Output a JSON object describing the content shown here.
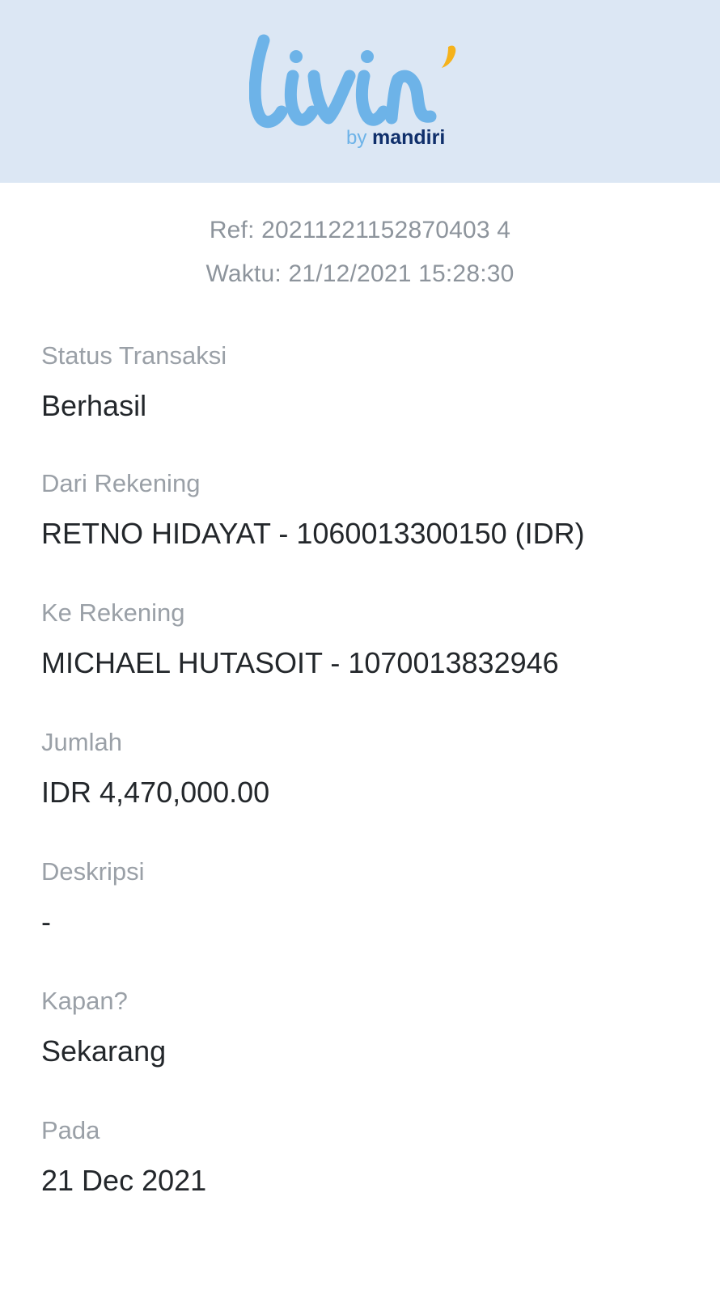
{
  "header": {
    "logo_text": "livin'",
    "logo_subtext_by": "by",
    "logo_subtext_brand": "mandiri",
    "background_color": "#dce7f4",
    "logo_color": "#6db3e8",
    "accent_color": "#f5b21b",
    "brand_color": "#0f2f6b"
  },
  "meta": {
    "ref": "Ref: 20211221152870403 4",
    "time": "Waktu: 21/12/2021 15:28:30"
  },
  "fields": [
    {
      "label": "Status Transaksi",
      "value": "Berhasil"
    },
    {
      "label": "Dari Rekening",
      "value": "RETNO HIDAYAT - 1060013300150 (IDR)"
    },
    {
      "label": "Ke Rekening",
      "value": "MICHAEL HUTASOIT - 1070013832946"
    },
    {
      "label": "Jumlah",
      "value": "IDR 4,470,000.00"
    },
    {
      "label": "Deskripsi",
      "value": "-"
    },
    {
      "label": "Kapan?",
      "value": "Sekarang"
    },
    {
      "label": "Pada",
      "value": "21 Dec 2021"
    }
  ]
}
